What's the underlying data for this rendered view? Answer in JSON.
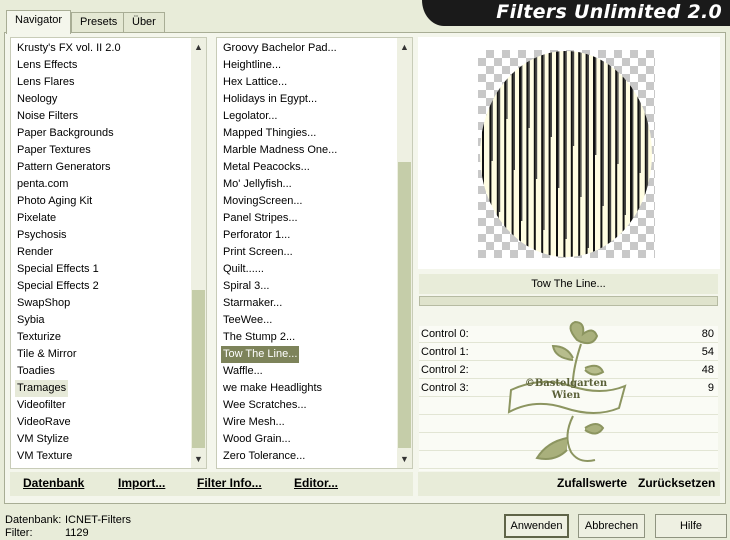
{
  "app_title": "Filters Unlimited 2.0",
  "tabs": [
    "Navigator",
    "Presets",
    "Über"
  ],
  "categories": [
    "Krusty's FX vol. II 2.0",
    "Lens Effects",
    "Lens Flares",
    "Neology",
    "Noise Filters",
    "Paper Backgrounds",
    "Paper Textures",
    "Pattern Generators",
    "penta.com",
    "Photo Aging Kit",
    "Pixelate",
    "Psychosis",
    "Render",
    "Special Effects 1",
    "Special Effects 2",
    "SwapShop",
    "Sybia",
    "Texturize",
    "Tile & Mirror",
    "Toadies",
    "Tramages",
    "Videofilter",
    "VideoRave",
    "VM Stylize",
    "VM Texture"
  ],
  "selected_category": "Tramages",
  "filters": [
    "Groovy Bachelor Pad...",
    "Heightline...",
    "Hex Lattice...",
    "Holidays in Egypt...",
    "Legolator...",
    "Mapped Thingies...",
    "Marble Madness One...",
    "Metal Peacocks...",
    "Mo' Jellyfish...",
    "MovingScreen...",
    "Panel Stripes...",
    "Perforator 1...",
    "Print Screen...",
    "Quilt......",
    "Spiral 3...",
    "Starmaker...",
    "TeeWee...",
    "The Stump 2...",
    "Tow The Line...",
    "Waffle...",
    "we make Headlights",
    "Wee Scratches...",
    "Wire Mesh...",
    "Wood Grain...",
    "Zero Tolerance..."
  ],
  "selected_filter": "Tow The Line...",
  "current_filter_name": "Tow The Line...",
  "controls": [
    {
      "label": "Control 0:",
      "value": "80"
    },
    {
      "label": "Control 1:",
      "value": "54"
    },
    {
      "label": "Control 2:",
      "value": "48"
    },
    {
      "label": "Control 3:",
      "value": "9"
    }
  ],
  "watermark": "©Bastelgarten Wien",
  "bottom_links": {
    "datenbank": "Datenbank",
    "import": "Import...",
    "filter_info": "Filter Info...",
    "editor": "Editor...",
    "zufallswerte": "Zufallswerte",
    "zuruecksetzen": "Zurücksetzen"
  },
  "status": {
    "datenbank_label": "Datenbank:",
    "datenbank_value": "ICNET-Filters",
    "filter_label": "Filter:",
    "filter_value": "1129"
  },
  "buttons": {
    "apply": "Anwenden",
    "cancel": "Abbrechen",
    "help": "Hilfe"
  },
  "colors": {
    "accent": "#7d835a",
    "background": "#e8ecd9",
    "banner": "#1a1a1a",
    "watermark": "#8c9560"
  }
}
